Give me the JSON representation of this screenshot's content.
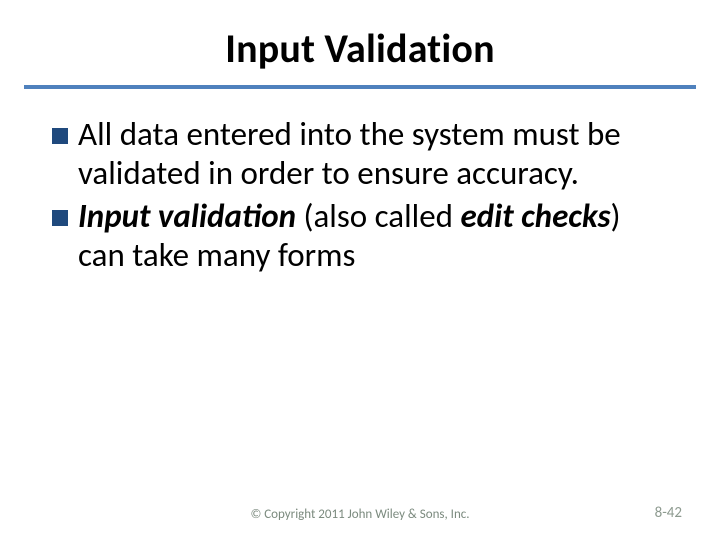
{
  "title": "Input Validation",
  "bullets": [
    {
      "segments": [
        {
          "text": "All data entered into the system must be validated in order to ensure accuracy.",
          "style": "plain"
        }
      ]
    },
    {
      "segments": [
        {
          "text": "Input validation",
          "style": "bi"
        },
        {
          "text": " (also called ",
          "style": "plain"
        },
        {
          "text": "edit checks",
          "style": "bi"
        },
        {
          "text": ") can take many forms",
          "style": "plain"
        }
      ]
    }
  ],
  "footer": {
    "copyright": "© Copyright 2011 John Wiley & Sons, Inc.",
    "page": "8-42"
  }
}
